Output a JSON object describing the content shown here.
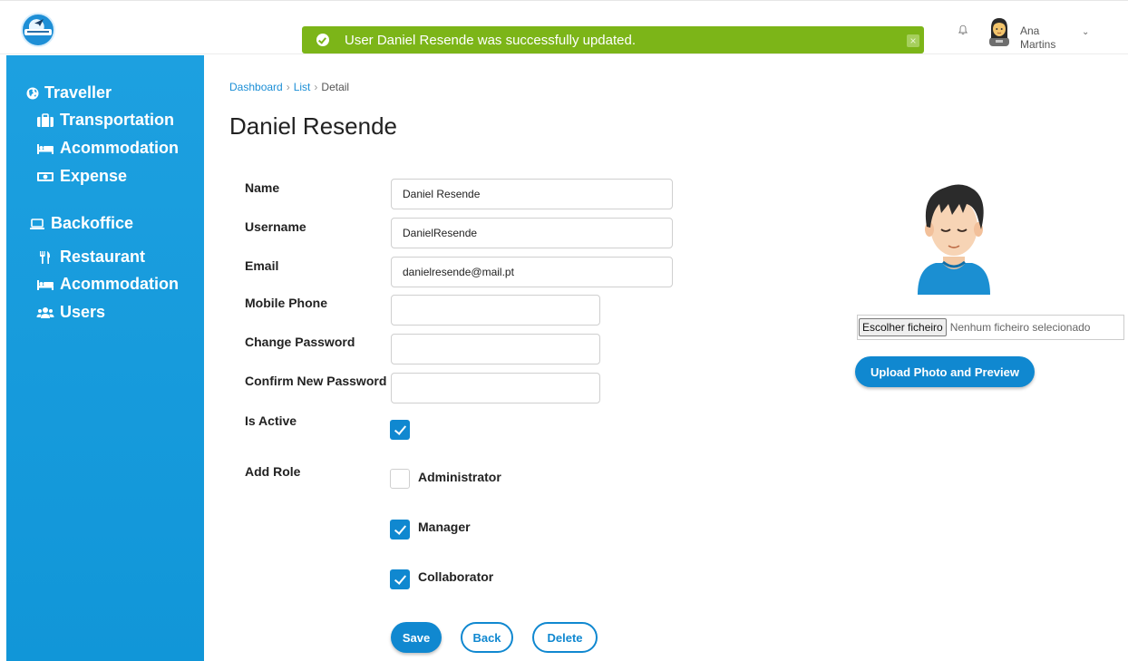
{
  "toast": {
    "message": "User Daniel Resende was successfully updated.",
    "close_label": "×"
  },
  "user": {
    "first_name": "Ana",
    "last_name": "Martins",
    "chevron": "⌄"
  },
  "sidebar": {
    "traveller": {
      "label": "Traveller",
      "items": [
        {
          "label": "Transportation",
          "icon": "suitcase-icon"
        },
        {
          "label": "Acommodation",
          "icon": "bed-icon"
        },
        {
          "label": "Expense",
          "icon": "money-icon"
        }
      ]
    },
    "backoffice": {
      "label": "Backoffice",
      "items": [
        {
          "label": "Restaurant",
          "icon": "utensils-icon"
        },
        {
          "label": "Acommodation",
          "icon": "bed-icon"
        },
        {
          "label": "Users",
          "icon": "users-icon"
        }
      ]
    }
  },
  "breadcrumb": {
    "items": [
      "Dashboard",
      "List",
      "Detail"
    ],
    "separator": "›"
  },
  "page": {
    "title": "Daniel Resende"
  },
  "form": {
    "name": {
      "label": "Name",
      "value": "Daniel Resende"
    },
    "username": {
      "label": "Username",
      "value": "DanielResende"
    },
    "email": {
      "label": "Email",
      "value": "danielresende@mail.pt"
    },
    "mobile": {
      "label": "Mobile Phone",
      "value": ""
    },
    "change_password": {
      "label": "Change Password",
      "value": ""
    },
    "confirm_password": {
      "label": "Confirm New Password",
      "value": ""
    },
    "is_active": {
      "label": "Is Active",
      "checked": true
    },
    "roles": {
      "label": "Add Role",
      "items": [
        {
          "label": "Administrator",
          "checked": false
        },
        {
          "label": "Manager",
          "checked": true
        },
        {
          "label": "Collaborator",
          "checked": true
        }
      ]
    }
  },
  "actions": {
    "save": "Save",
    "back": "Back",
    "delete": "Delete"
  },
  "photo": {
    "file_button": "Escolher ficheiro",
    "file_status": "Nenhum ficheiro selecionado",
    "upload_button": "Upload Photo and Preview"
  },
  "colors": {
    "sidebar": "#1da0e0",
    "primary": "#1088d0",
    "toast": "#7cb518"
  }
}
